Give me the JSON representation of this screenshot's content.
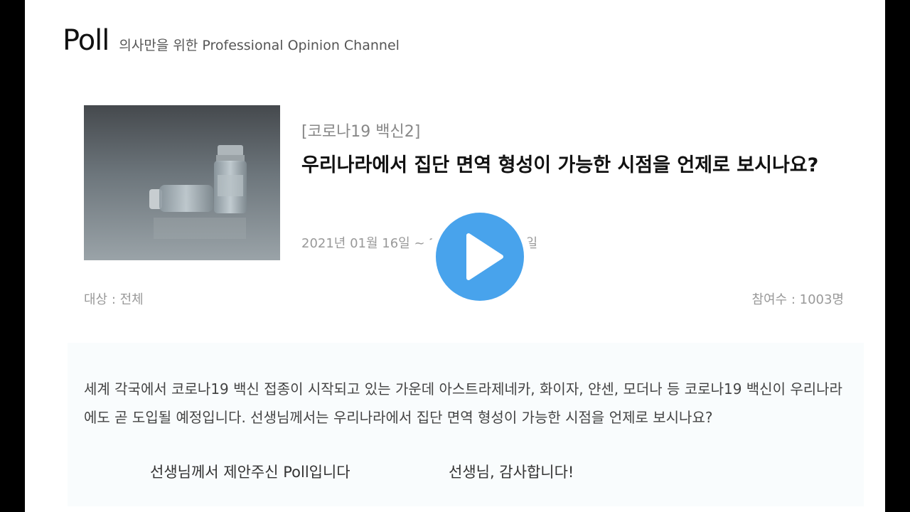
{
  "header": {
    "logo": "Poll",
    "tagline": "의사만을 위한 Professional Opinion Channel"
  },
  "poll": {
    "category": "[코로나19 백신2]",
    "title": "우리나라에서 집단 면역 형성이 가능한 시점을 언제로 보시나요?",
    "date_range": "2021년 01월 16일 ~ 2021년 02월 06일",
    "target": "대상 : 전체",
    "participants": "참여수 : 1003명",
    "description": "세계 각국에서 코로나19 백신 접종이 시작되고 있는 가운데 아스트라제네카, 화이자, 얀센, 모더나 등 코로나19 백신이 우리나라에도 곧 도입될 예정입니다. 선생님께서는 우리나라에서 집단 면역 형성이 가능한 시점을 언제로 보시나요?",
    "footer_left": "선생님께서 제안주신 Poll입니다",
    "footer_right": "선생님, 감사합니다!"
  },
  "icons": {
    "thumbnail": "vaccine-vial-image",
    "play": "play-icon"
  },
  "colors": {
    "play_accent": "#48a3ec",
    "background": "#000000",
    "panel": "#ffffff"
  }
}
